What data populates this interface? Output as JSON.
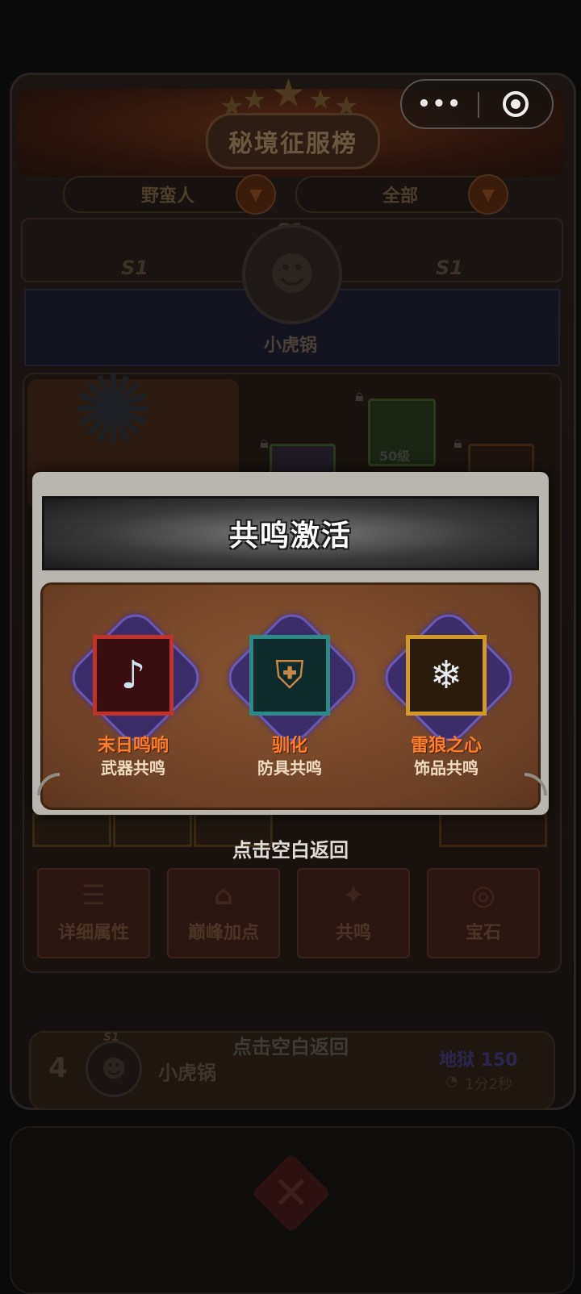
{
  "colors": {
    "overlay": "#0b0a0a",
    "modal_body": "#7a4a2a",
    "item_name": "#ff7d2a",
    "item_sub": "#f0dcc0",
    "weapon_frame": "#c0332a",
    "armor_frame": "#2d8a86",
    "accessory_frame": "#d29a24"
  },
  "capsule": {
    "more_icon": "more-dots-icon",
    "close_icon": "target-close-icon"
  },
  "background": {
    "banner_title": "秘境征服榜",
    "filter_class": "野蛮人",
    "filter_scope": "全部",
    "season_tags": [
      "S1",
      "S1",
      "S1"
    ],
    "top_player_name": "小虎锅",
    "gear_level_tag": "50级",
    "actions": [
      {
        "label": "详细属性",
        "icon": "list-icon"
      },
      {
        "label": "巅峰加点",
        "icon": "house-icon"
      },
      {
        "label": "共鸣",
        "icon": "resonance-icon"
      },
      {
        "label": "宝石",
        "icon": "gem-icon"
      }
    ],
    "rank_row": {
      "rank": "4",
      "season": "S1",
      "name": "小虎锅",
      "level": "地狱 150",
      "time": "1分2秒"
    },
    "dim_hint": "点击空白返回"
  },
  "modal": {
    "title": "共鸣激活",
    "items": [
      {
        "name": "末日鸣响",
        "type": "武器共鸣",
        "icon": "horn-icon"
      },
      {
        "name": "驯化",
        "type": "防具共鸣",
        "icon": "armor-icon"
      },
      {
        "name": "雷狼之心",
        "type": "饰品共鸣",
        "icon": "wolf-amulet-icon"
      }
    ]
  },
  "hint": "点击空白返回"
}
